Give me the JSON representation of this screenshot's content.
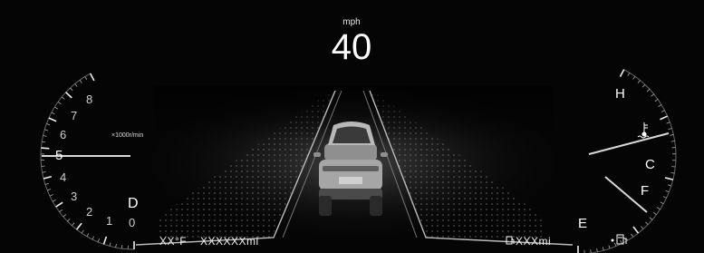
{
  "speedometer": {
    "unit": "mph",
    "value": "40"
  },
  "tachometer": {
    "unit": "×1000r/min",
    "labels": [
      "0",
      "1",
      "2",
      "3",
      "4",
      "5",
      "6",
      "7",
      "8"
    ],
    "needle_value_x1000": 5.0
  },
  "gear": "D",
  "outside_temperature": "XX°F",
  "odometer": "XXXXXXmi",
  "fuel_range": "XXXmi",
  "temperature_gauge": {
    "high_label": "H",
    "low_label": "C",
    "icon": "coolant-temperature-icon"
  },
  "fuel_gauge": {
    "full_label": "F",
    "empty_label": "E",
    "icon": "fuel-pump-icon"
  },
  "colors": {
    "background": "#050505",
    "text": "#ffffff",
    "needle": "#d8d8d8",
    "lane": "#bbbbbb"
  }
}
